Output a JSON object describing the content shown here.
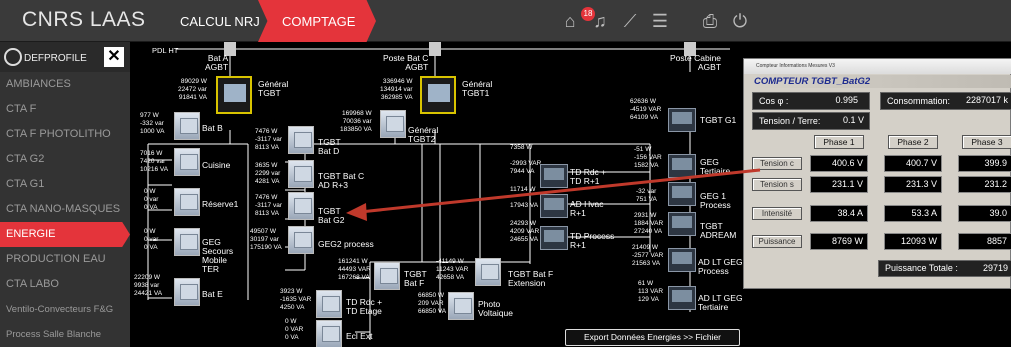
{
  "app": {
    "brand": "CNRS LAAS"
  },
  "tabs": {
    "calc": "CALCUL NRJ",
    "comptage": "COMPTAGE"
  },
  "toolbar": {
    "alert_count": "18"
  },
  "profile": {
    "name": "DEFPROFILE",
    "close": "✕"
  },
  "sidebar": {
    "items": [
      {
        "label": "AMBIANCES"
      },
      {
        "label": "CTA F"
      },
      {
        "label": "CTA F PHOTOLITHO"
      },
      {
        "label": "CTA G2"
      },
      {
        "label": "CTA G1"
      },
      {
        "label": "CTA NANO-MASQUES"
      },
      {
        "label": "ENERGIE"
      },
      {
        "label": "PRODUCTION EAU"
      },
      {
        "label": "CTA LABO"
      },
      {
        "label": "Ventilo-Convecteurs F&G"
      },
      {
        "label": "Process Salle Blanche"
      }
    ]
  },
  "diagram": {
    "pdl": "PDL HT",
    "bat_a": "Bat A\nAGBT",
    "poste_bat_c": "Poste Bat C\nAGBT",
    "poste_cabine": "Poste Cabine\nAGBT",
    "general_tgbt": "Général\nTGBT",
    "general_tgbt1": "Général\nTGBT1",
    "general_tgbt2": "Général\nTGBT2",
    "gen_vals": "89029 W\n22472 var\n91841 VA",
    "gen1_vals": "336946 W\n134914 var\n362985 VA",
    "gen2_vals": "169968 W\n70036 var\n183850 VA",
    "batb": "Bat B",
    "batb_vals": "977 W\n-332 var\n1000 VA",
    "cuisine": "Cuisine",
    "cuisine_vals": "7016 W\n7420 var\n10216 VA",
    "reserve": "Réserve1",
    "reserve_vals": "0 W\n0 var\n0 VA",
    "geg_secours": "GEG\nSecours\nMobile\nTER",
    "geg_secours_vals": "0 W\n0 var\n0 VA",
    "bate": "Bat E",
    "bate_vals": "22209 W\n9938 var\n24421 VA",
    "tgbt_batd": "TGBT\nBat D",
    "tgbt_batd_vals": "7476 W\n-3117 var\n8113 VA",
    "tgbt_batc": "TGBT Bat C\nAD R+3",
    "tgbt_batc_vals": "3635 W\n2299 var\n4281 VA",
    "tgbt_batg2": "TGBT\nBat G2",
    "tgbt_batg2_vals": "7476 W\n-3117 var\n8113 VA",
    "geg2": "GEG2 process",
    "geg2_vals": "49507 W\n30197 var\n175190 VA",
    "tgbt_batf": "TGBT\nBat F",
    "tgbt_batf_vals": "161241 W\n44493 VAR\n167268 VA",
    "tgbt_batf_ext": "TGBT Bat F\nExtension",
    "tgbt_batf_ext_vals": "-41149 W\n11243 VAR\n42658 VA",
    "tdrdc_etage": "TD Rdc +\nTD Etage",
    "tdrdc_etage_vals": "3923 W\n-1635 VAR\n4250 VA",
    "ecl_ext": "Ecl Ext",
    "ecl_ext_vals": "0 W\n0 VAR\n0 VA",
    "photo": "Photo\nVoltaique",
    "photo_vals": "66850 W\n209 VAR\n66850 VA",
    "td_rdc_r1": "TD Rdc +\nTD R+1",
    "td_rdc_r1_vals": "7358 W\n\n-2993 VAR\n7944 VA",
    "ad_hvac": "AD Hvac\nR+1",
    "ad_hvac_vals": "11714 W\n\n17943 VA",
    "td_process": "TD Process\nR+1",
    "td_process_vals": "24293 W\n4209 VAR\n24655 VA",
    "tgbt_g1": "TGBT G1",
    "tgbt_g1_vals": "62636 W\n-4519 VAR\n64109 VA",
    "geg_tert": "GEG\nTertiaire",
    "geg_tert_vals": "-51 W\n-156 VAR\n1582 VA",
    "geg1_proc": "GEG 1\nProcess",
    "geg1_proc_vals": "-32 var\n751 VA",
    "tgbt_adream": "TGBT\nADREAM",
    "tgbt_adream_vals": "2931 W\n1884 VAR\n27240 VA",
    "adlt_proc": "AD LT GEG\nProcess",
    "adlt_proc_vals": "21409 W\n-2577 VAR\n21563 VA",
    "adlt_tert": "AD LT GEG\nTertiaire",
    "adlt_tert_vals": "61 W\n113 VAR\n129 VA",
    "export": "Export Données Energies >> Fichier"
  },
  "popup": {
    "titlebar": "Compteur Informations Mesures V3",
    "heading": "COMPTEUR  TGBT_BatG2",
    "cos_label": "Cos φ :",
    "cos_value": "0.995",
    "consommation_label": "Consommation:",
    "consommation_value": "2287017 k",
    "tension_terre_label": "Tension / Terre:",
    "tension_terre_value": "0.1 V",
    "phase_headers": [
      "Phase 1",
      "Phase 2",
      "Phase 3"
    ],
    "rows": [
      {
        "label": "Tension c",
        "values": [
          "400.6 V",
          "400.7 V",
          "399.9"
        ]
      },
      {
        "label": "Tension s",
        "values": [
          "231.1 V",
          "231.3 V",
          "231.2"
        ]
      },
      {
        "label": "Intensité",
        "values": [
          "38.4 A",
          "53.3 A",
          "39.0"
        ]
      },
      {
        "label": "Puissance",
        "values": [
          "8769 W",
          "12093 W",
          "8857"
        ]
      }
    ],
    "puissance_totale_label": "Puissance Totale :",
    "puissance_totale_value": "29719"
  },
  "colors": {
    "accent": "#e4343b",
    "topbar": "#3a3a3a",
    "sidebar": "#333333",
    "arrow": "#c0392b"
  }
}
